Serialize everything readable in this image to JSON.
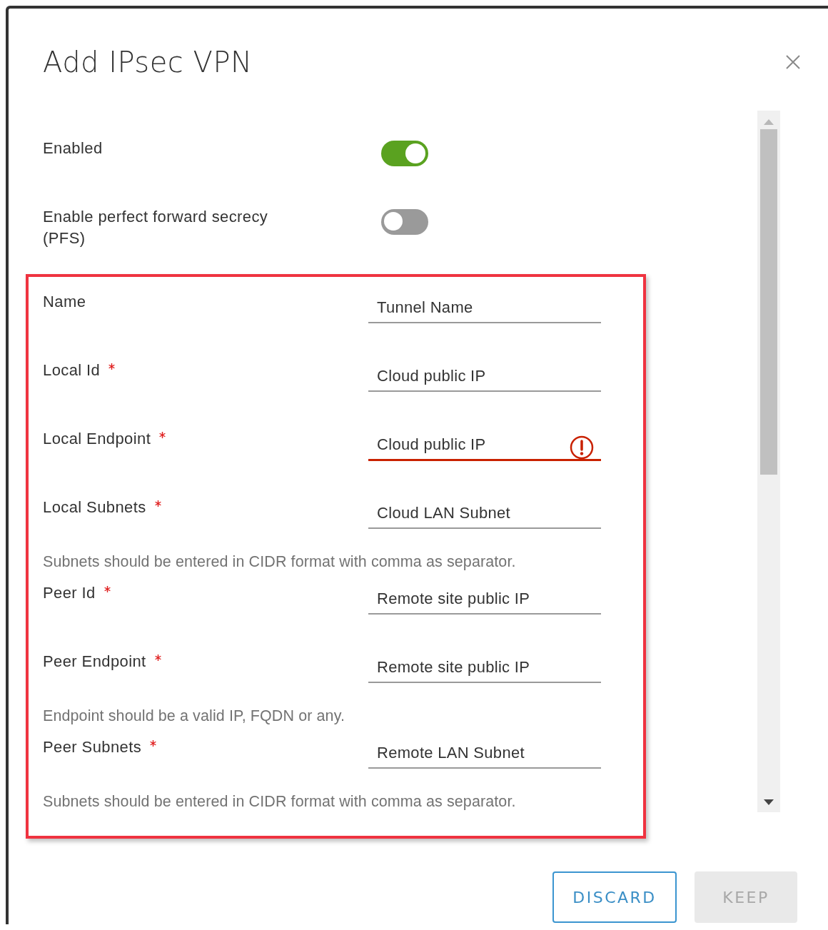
{
  "dialog": {
    "title": "Add IPsec VPN"
  },
  "toggles": [
    {
      "label": "Enabled",
      "on": true
    },
    {
      "label": "Enable perfect forward secrecy (PFS)",
      "on": false
    }
  ],
  "fields": [
    {
      "kind": "field",
      "label": "Name",
      "required": false,
      "value": "Tunnel Name",
      "error": false
    },
    {
      "kind": "field",
      "label": "Local Id",
      "required": true,
      "value": "Cloud public IP",
      "error": false
    },
    {
      "kind": "field",
      "label": "Local Endpoint",
      "required": true,
      "value": "Cloud public IP",
      "error": true
    },
    {
      "kind": "field",
      "label": "Local Subnets",
      "required": true,
      "value": "Cloud LAN Subnet",
      "error": false
    },
    {
      "kind": "hint",
      "text": "Subnets should be entered in CIDR format with comma as separator."
    },
    {
      "kind": "field",
      "label": "Peer Id",
      "required": true,
      "value": "Remote site public IP",
      "error": false
    },
    {
      "kind": "field",
      "label": "Peer Endpoint",
      "required": true,
      "value": "Remote site public IP",
      "error": false
    },
    {
      "kind": "hint",
      "text": "Endpoint should be a valid IP, FQDN or any."
    },
    {
      "kind": "field",
      "label": "Peer Subnets",
      "required": true,
      "value": "Remote LAN Subnet",
      "error": false
    },
    {
      "kind": "hint",
      "text": "Subnets should be entered in CIDR format with comma as separator."
    }
  ],
  "buttons": [
    {
      "label": "DISCARD",
      "disabled": false
    },
    {
      "label": "KEEP",
      "disabled": true
    }
  ]
}
